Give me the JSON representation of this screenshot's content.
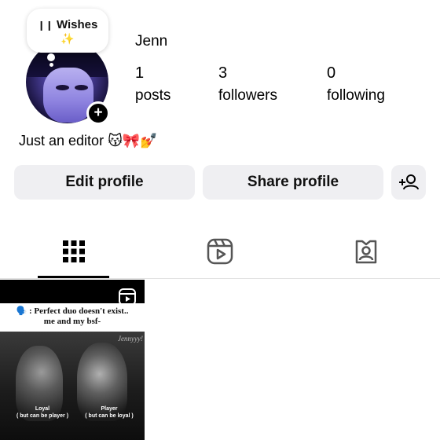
{
  "note": {
    "text": "Wishes",
    "emoji": "✨",
    "icon": "music-bars-icon"
  },
  "profile": {
    "username": "Jenn",
    "bio": "Just an editor 😽🎀💅"
  },
  "stats": [
    {
      "value": "1",
      "label": "posts"
    },
    {
      "value": "3",
      "label": "followers"
    },
    {
      "value": "0",
      "label": "following"
    }
  ],
  "buttons": {
    "edit": "Edit profile",
    "share": "Share profile",
    "add_person_icon": "add-person-icon"
  },
  "tabs": [
    {
      "name": "grid",
      "icon": "grid-icon",
      "active": true
    },
    {
      "name": "reels",
      "icon": "reels-icon",
      "active": false
    },
    {
      "name": "tagged",
      "icon": "tagged-icon",
      "active": false
    }
  ],
  "post": {
    "caption_line1": "🗣️ : Perfect duo doesn't exist..",
    "caption_line2": "me and my bsf-",
    "watermark": "Jennyyy!",
    "left_label_1": "Loyal",
    "left_label_2": "( but can be player )",
    "right_label_1": "Player",
    "right_label_2": "( but can be loyal )"
  },
  "colors": {
    "button_bg": "#efeff2",
    "text": "#000000"
  }
}
